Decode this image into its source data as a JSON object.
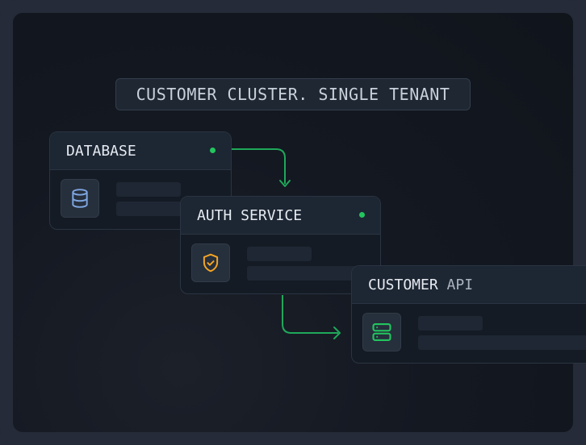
{
  "banner": {
    "label": "CUSTOMER CLUSTER. SINGLE TENANT"
  },
  "nodes": [
    {
      "id": "database",
      "title": "DATABASE",
      "status": "online",
      "icon": "database-icon",
      "icon_color": "#7ea6e0"
    },
    {
      "id": "auth",
      "title": "AUTH SERVICE",
      "status": "online",
      "icon": "shield-check-icon",
      "icon_color": "#f5a524"
    },
    {
      "id": "api",
      "title_main": "CUSTOMER",
      "title_dim": "API",
      "icon": "server-icon",
      "icon_color": "#22c55e"
    }
  ],
  "edges": [
    {
      "from": "database",
      "to": "auth"
    },
    {
      "from": "auth",
      "to": "api"
    }
  ],
  "colors": {
    "accent_green": "#22c55e",
    "connector": "#1fa85a",
    "background": "#10141b"
  }
}
